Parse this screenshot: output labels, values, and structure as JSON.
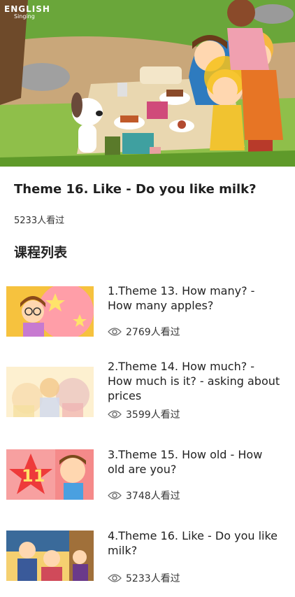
{
  "hero": {
    "logo_line1": "ENGLISH",
    "logo_line2": "Singing"
  },
  "course": {
    "title": "Theme 16. Like - Do you like milk?",
    "views": "5233人看过"
  },
  "section": {
    "title": "课程列表"
  },
  "lessons": [
    {
      "title": "1.Theme 13. How many?  - How many apples?",
      "views": "2769人看过"
    },
    {
      "title": "2.Theme 14. How much?  - How much is it?  - asking about prices",
      "views": "3599人看过"
    },
    {
      "title": "3.Theme 15. How old - How old are you?",
      "views": "3748人看过"
    },
    {
      "title": "4.Theme 16. Like - Do you like milk?",
      "views": "5233人看过"
    }
  ],
  "thumb_text": {
    "lesson3_number": "11"
  },
  "icons": {
    "views": "eye-icon"
  }
}
